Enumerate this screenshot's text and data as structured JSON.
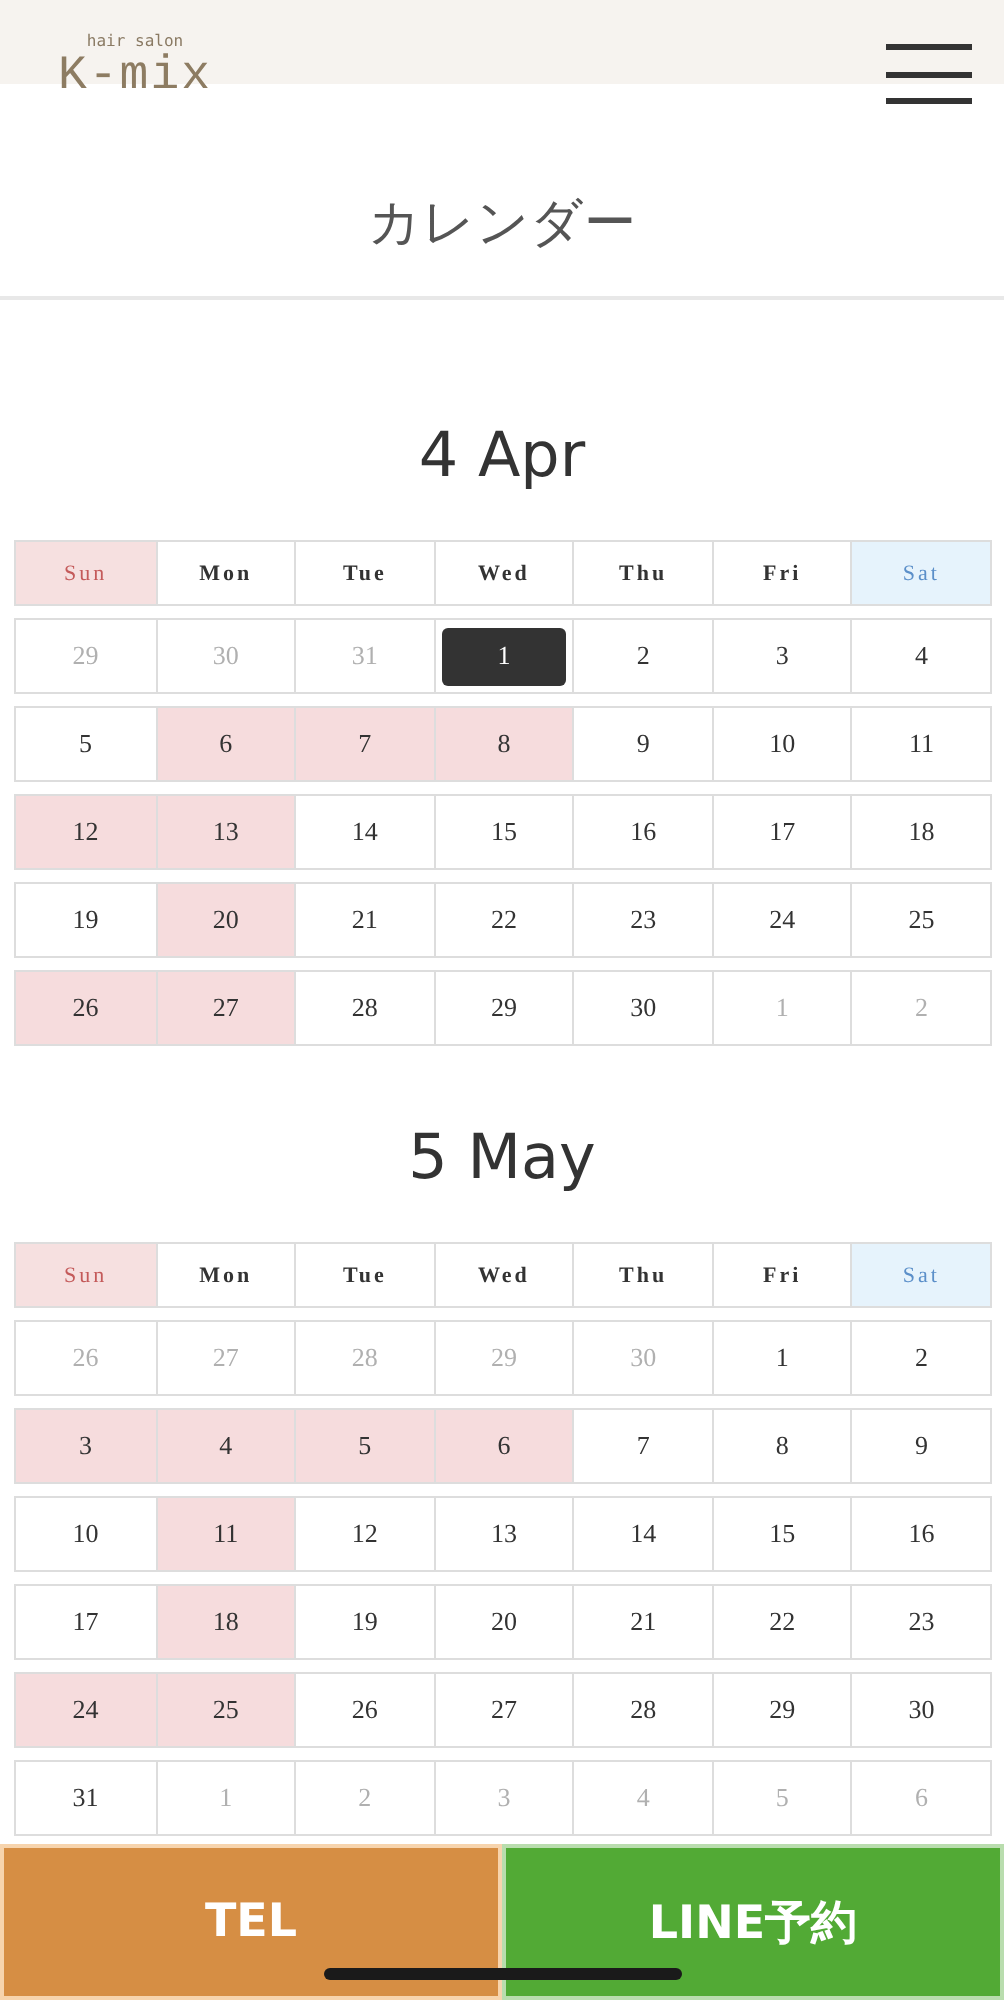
{
  "header": {
    "logo_caption": "hair salon",
    "logo": "K-mix"
  },
  "page_title": "カレンダー",
  "months": [
    {
      "title": "4 Apr",
      "weekdays": [
        {
          "label": "Sun",
          "kind": "sun"
        },
        {
          "label": "Mon",
          "kind": "weekday"
        },
        {
          "label": "Tue",
          "kind": "weekday"
        },
        {
          "label": "Wed",
          "kind": "weekday"
        },
        {
          "label": "Thu",
          "kind": "weekday"
        },
        {
          "label": "Fri",
          "kind": "weekday"
        },
        {
          "label": "Sat",
          "kind": "sat"
        }
      ],
      "weeks": [
        [
          {
            "label": "29",
            "kind": "other"
          },
          {
            "label": "30",
            "kind": "other"
          },
          {
            "label": "31",
            "kind": "other"
          },
          {
            "label": "1",
            "kind": "today"
          },
          {
            "label": "2",
            "kind": "open"
          },
          {
            "label": "3",
            "kind": "open"
          },
          {
            "label": "4",
            "kind": "open"
          }
        ],
        [
          {
            "label": "5",
            "kind": "open"
          },
          {
            "label": "6",
            "kind": "closed"
          },
          {
            "label": "7",
            "kind": "closed"
          },
          {
            "label": "8",
            "kind": "closed"
          },
          {
            "label": "9",
            "kind": "open"
          },
          {
            "label": "10",
            "kind": "open"
          },
          {
            "label": "11",
            "kind": "open"
          }
        ],
        [
          {
            "label": "12",
            "kind": "closed"
          },
          {
            "label": "13",
            "kind": "closed"
          },
          {
            "label": "14",
            "kind": "open"
          },
          {
            "label": "15",
            "kind": "open"
          },
          {
            "label": "16",
            "kind": "open"
          },
          {
            "label": "17",
            "kind": "open"
          },
          {
            "label": "18",
            "kind": "open"
          }
        ],
        [
          {
            "label": "19",
            "kind": "open"
          },
          {
            "label": "20",
            "kind": "closed"
          },
          {
            "label": "21",
            "kind": "open"
          },
          {
            "label": "22",
            "kind": "open"
          },
          {
            "label": "23",
            "kind": "open"
          },
          {
            "label": "24",
            "kind": "open"
          },
          {
            "label": "25",
            "kind": "open"
          }
        ],
        [
          {
            "label": "26",
            "kind": "closed"
          },
          {
            "label": "27",
            "kind": "closed"
          },
          {
            "label": "28",
            "kind": "open"
          },
          {
            "label": "29",
            "kind": "open"
          },
          {
            "label": "30",
            "kind": "open"
          },
          {
            "label": "1",
            "kind": "other"
          },
          {
            "label": "2",
            "kind": "other"
          }
        ]
      ]
    },
    {
      "title": "5 May",
      "weekdays": [
        {
          "label": "Sun",
          "kind": "sun"
        },
        {
          "label": "Mon",
          "kind": "weekday"
        },
        {
          "label": "Tue",
          "kind": "weekday"
        },
        {
          "label": "Wed",
          "kind": "weekday"
        },
        {
          "label": "Thu",
          "kind": "weekday"
        },
        {
          "label": "Fri",
          "kind": "weekday"
        },
        {
          "label": "Sat",
          "kind": "sat"
        }
      ],
      "weeks": [
        [
          {
            "label": "26",
            "kind": "other"
          },
          {
            "label": "27",
            "kind": "other"
          },
          {
            "label": "28",
            "kind": "other"
          },
          {
            "label": "29",
            "kind": "other"
          },
          {
            "label": "30",
            "kind": "other"
          },
          {
            "label": "1",
            "kind": "open"
          },
          {
            "label": "2",
            "kind": "open"
          }
        ],
        [
          {
            "label": "3",
            "kind": "closed"
          },
          {
            "label": "4",
            "kind": "closed"
          },
          {
            "label": "5",
            "kind": "closed"
          },
          {
            "label": "6",
            "kind": "closed"
          },
          {
            "label": "7",
            "kind": "open"
          },
          {
            "label": "8",
            "kind": "open"
          },
          {
            "label": "9",
            "kind": "open"
          }
        ],
        [
          {
            "label": "10",
            "kind": "open"
          },
          {
            "label": "11",
            "kind": "closed"
          },
          {
            "label": "12",
            "kind": "open"
          },
          {
            "label": "13",
            "kind": "open"
          },
          {
            "label": "14",
            "kind": "open"
          },
          {
            "label": "15",
            "kind": "open"
          },
          {
            "label": "16",
            "kind": "open"
          }
        ],
        [
          {
            "label": "17",
            "kind": "open"
          },
          {
            "label": "18",
            "kind": "closed"
          },
          {
            "label": "19",
            "kind": "open"
          },
          {
            "label": "20",
            "kind": "open"
          },
          {
            "label": "21",
            "kind": "open"
          },
          {
            "label": "22",
            "kind": "open"
          },
          {
            "label": "23",
            "kind": "open"
          }
        ],
        [
          {
            "label": "24",
            "kind": "closed"
          },
          {
            "label": "25",
            "kind": "closed"
          },
          {
            "label": "26",
            "kind": "open"
          },
          {
            "label": "27",
            "kind": "open"
          },
          {
            "label": "28",
            "kind": "open"
          },
          {
            "label": "29",
            "kind": "open"
          },
          {
            "label": "30",
            "kind": "open"
          }
        ],
        [
          {
            "label": "31",
            "kind": "open"
          },
          {
            "label": "1",
            "kind": "other"
          },
          {
            "label": "2",
            "kind": "other"
          },
          {
            "label": "3",
            "kind": "other"
          },
          {
            "label": "4",
            "kind": "other"
          },
          {
            "label": "5",
            "kind": "other"
          },
          {
            "label": "6",
            "kind": "other"
          }
        ]
      ]
    }
  ],
  "bottom_bar": [
    {
      "label": "TEL",
      "kind": "tel"
    },
    {
      "label": "LINE予約",
      "kind": "line"
    }
  ]
}
